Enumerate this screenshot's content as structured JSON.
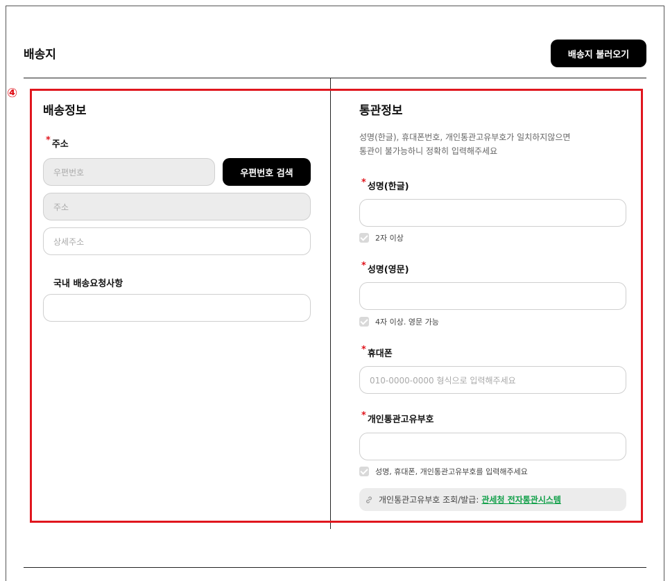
{
  "header": {
    "title": "배송지",
    "load_button": "배송지 불러오기"
  },
  "badge": "④",
  "shipping": {
    "title": "배송정보",
    "address_label": "주소",
    "required_mark": "*",
    "postcode_placeholder": "우편번호",
    "postcode_search_button": "우편번호 검색",
    "address_placeholder": "주소",
    "detail_address_placeholder": "상세주소",
    "request_label": "국내 배송요청사항",
    "request_value": ""
  },
  "customs": {
    "title": "통관정보",
    "notice_line1": "성명(한글), 휴대폰번호, 개인통관고유부호가 일치하지않으면",
    "notice_line2": "통관이 불가능하니 정확히 입력해주세요",
    "name_kr_label": "성명(한글)",
    "name_kr_value": "",
    "name_kr_hint": "2자 이상",
    "name_en_label": "성명(영문)",
    "name_en_value": "",
    "name_en_hint": "4자 이상. 영문 가능",
    "phone_label": "휴대폰",
    "phone_placeholder": "010-0000-0000 형식으로 입력해주세요",
    "pccc_label": "개인통관고유부호",
    "pccc_value": "",
    "pccc_hint": "성명, 휴대폰, 개인통관고유부호를 입력해주세요",
    "lookup_text": "개인통관고유부호 조회/발급:",
    "lookup_link": "관세청 전자통관시스템"
  },
  "colors": {
    "accent_red": "#e0161e",
    "link_green": "#12a04a",
    "button_black": "#000000"
  },
  "icons": [
    "link-icon",
    "check-icon"
  ]
}
